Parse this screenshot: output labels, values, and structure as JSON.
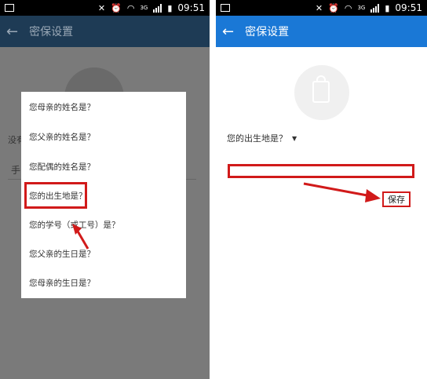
{
  "status_bar": {
    "time": "09:51",
    "network": "3G"
  },
  "left_screen": {
    "app_bar": {
      "back_icon": "←",
      "title": "密保设置"
    },
    "background": {
      "label_fragment": "没有",
      "field_fragment": "手"
    },
    "dialog_options": [
      "您母亲的姓名是？",
      "您父亲的姓名是？",
      "您配偶的姓名是？",
      "您的出生地是？",
      "您的学号（或工号）是？",
      "您父亲的生日是？",
      "您母亲的生日是？"
    ],
    "highlighted_index": 3
  },
  "right_screen": {
    "app_bar": {
      "back_icon": "←",
      "title": "密保设置"
    },
    "selected_question": "您的出生地是？",
    "answer_value": "",
    "save_label": "保存"
  },
  "colors": {
    "right_appbar": "#1a78d6",
    "left_appbar": "#1e3b55",
    "annotation_red": "#d11a1a"
  }
}
